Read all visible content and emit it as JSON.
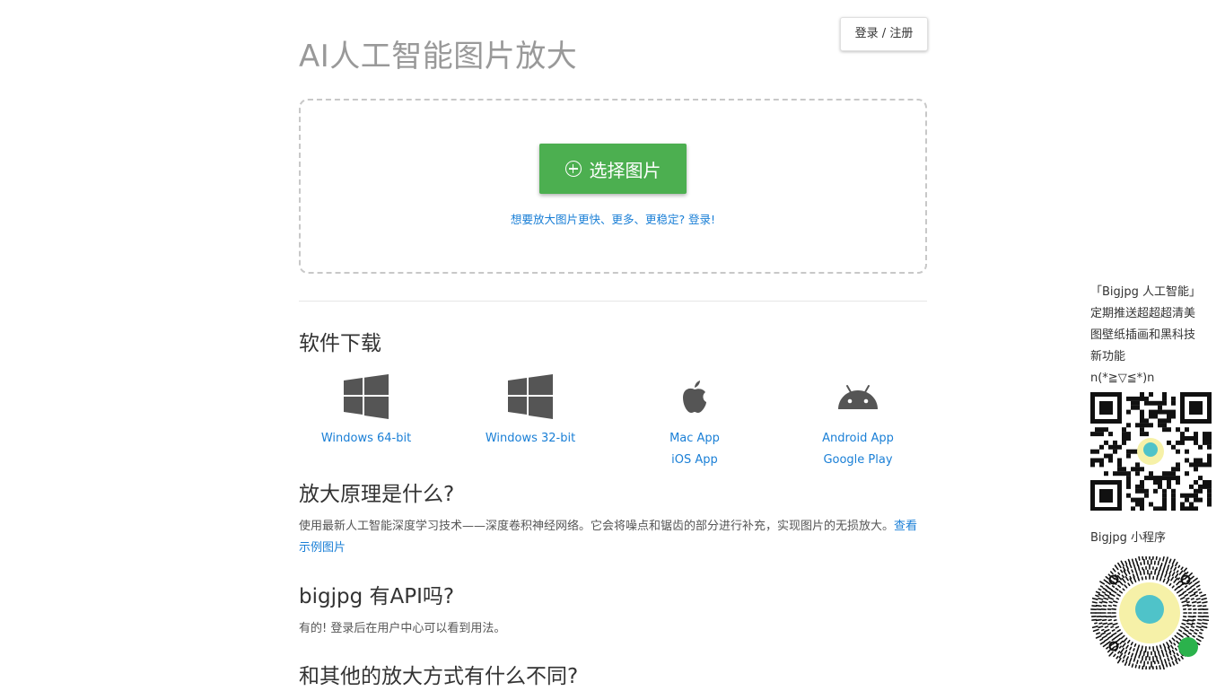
{
  "header": {
    "title": "AI人工智能图片放大",
    "login_label": "登录 / 注册"
  },
  "upload": {
    "button_label": "选择图片",
    "hint": "想要放大图片更快、更多、更稳定? 登录!"
  },
  "downloads": {
    "heading": "软件下载",
    "items": [
      {
        "icon": "windows-icon",
        "links": [
          "Windows 64-bit"
        ]
      },
      {
        "icon": "windows-icon",
        "links": [
          "Windows 32-bit"
        ]
      },
      {
        "icon": "apple-icon",
        "links": [
          "Mac App",
          "iOS App"
        ]
      },
      {
        "icon": "android-icon",
        "links": [
          "Android App",
          "Google Play"
        ]
      }
    ]
  },
  "faq": [
    {
      "question": "放大原理是什么?",
      "answer": "使用最新人工智能深度学习技术——深度卷积神经网络。它会将噪点和锯齿的部分进行补充，实现图片的无损放大。",
      "link": "查看示例图片"
    },
    {
      "question": "bigjpg 有API吗?",
      "answer": "有的! 登录后在用户中心可以看到用法。"
    },
    {
      "question": "和其他的放大方式有什么不同?"
    }
  ],
  "sidebar": {
    "lines": [
      "「Bigjpg 人工智能」",
      "定期推送超超超清美",
      "图壁纸插画和黑科技",
      "新功能",
      "n(*≧▽≦*)n"
    ],
    "mini_program_label": "Bigjpg 小程序"
  },
  "colors": {
    "accent_green": "#4caf50",
    "link_blue": "#1a7fd6",
    "title_gray": "#999999",
    "icon_gray": "#555555"
  }
}
